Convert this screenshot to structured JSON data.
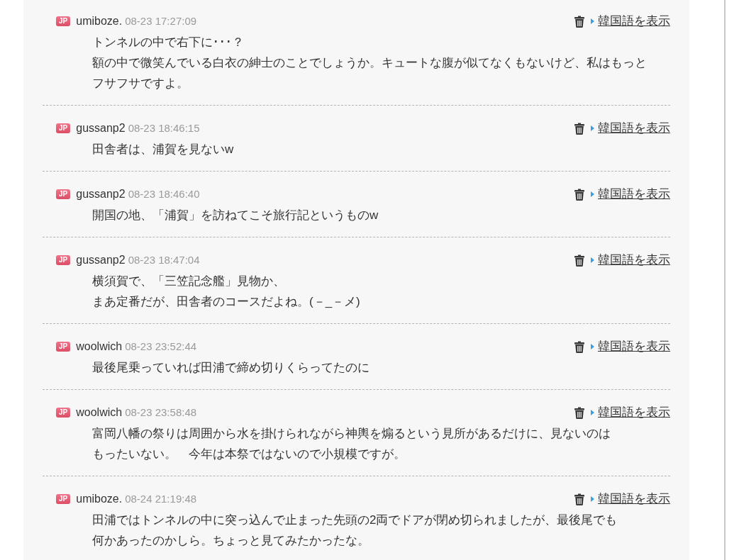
{
  "comments": [
    {
      "flag": "JP",
      "user": "umiboze.",
      "time": "08-23 17:27:09",
      "action": "韓国語を表示",
      "lines": [
        "トンネルの中で右下に･･･？",
        "額の中で微笑んでいる白衣の紳士のことでしょうか。キュートな腹が似てなくもないけど、私はもっと",
        "フサフサですよ。"
      ]
    },
    {
      "flag": "JP",
      "user": "gussanp2",
      "time": "08-23 18:46:15",
      "action": "韓国語を表示",
      "lines": [
        "田舎者は、浦賀を見ないw"
      ]
    },
    {
      "flag": "JP",
      "user": "gussanp2",
      "time": "08-23 18:46:40",
      "action": "韓国語を表示",
      "lines": [
        "開国の地、「浦賀」を訪ねてこそ旅行記というものw"
      ]
    },
    {
      "flag": "JP",
      "user": "gussanp2",
      "time": "08-23 18:47:04",
      "action": "韓国語を表示",
      "lines": [
        "横須賀で、「三笠記念艦」見物か、",
        "まあ定番だが、田舎者のコースだよね。(－_－メ)"
      ]
    },
    {
      "flag": "JP",
      "user": "woolwich",
      "time": "08-23 23:52:44",
      "action": "韓国語を表示",
      "lines": [
        "最後尾乗っていれば田浦で締め切りくらってたのに"
      ]
    },
    {
      "flag": "JP",
      "user": "woolwich",
      "time": "08-23 23:58:48",
      "action": "韓国語を表示",
      "lines": [
        "富岡八幡の祭りは周囲から水を掛けられながら神輿を煽るという見所があるだけに、見ないのは",
        "もったいない。　今年は本祭ではないので小規模ですが。"
      ]
    },
    {
      "flag": "JP",
      "user": "umiboze.",
      "time": "08-24 21:19:48",
      "action": "韓国語を表示",
      "lines": [
        "田浦ではトンネルの中に突っ込んで止まった先頭の2両でドアが閉め切られましたが、最後尾でも",
        "何かあったのかしら。ちょっと見てみたかったな。"
      ]
    }
  ]
}
